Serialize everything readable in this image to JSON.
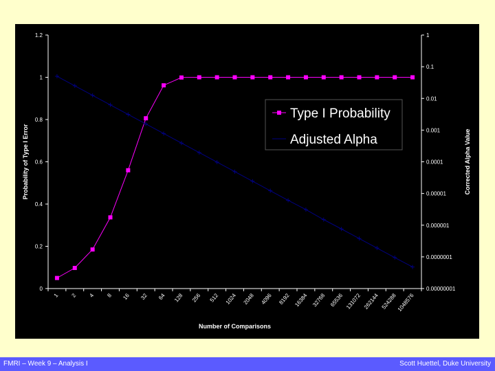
{
  "chart_data": {
    "type": "line",
    "xlabel": "Number of Comparisons",
    "ylabel": "Probability of Type I Error",
    "y2label": "Corrected Alpha Value",
    "categories": [
      "1",
      "2",
      "4",
      "8",
      "16",
      "32",
      "64",
      "128",
      "256",
      "512",
      "1024",
      "2048",
      "4096",
      "8192",
      "16384",
      "32768",
      "65536",
      "131072",
      "262144",
      "524288",
      "1048576"
    ],
    "ylim": [
      0,
      1.2
    ],
    "yticks": [
      "0",
      "0.2",
      "0.4",
      "0.6",
      "0.8",
      "1",
      "1.2"
    ],
    "y2lim": [
      1e-08,
      1
    ],
    "y2scale": "log",
    "y2ticks": [
      "0.00000001",
      "0.0000001",
      "0.000001",
      "0.00001",
      "0.0001",
      "0.001",
      "0.01",
      "0.1",
      "1"
    ],
    "legend_placement": "top-right",
    "grid": false,
    "series": [
      {
        "name": "Type I Probability",
        "axis": "left",
        "color": "#FF00FF",
        "marker": "square",
        "values": [
          0.05,
          0.0975,
          0.185,
          0.337,
          0.56,
          0.806,
          0.962,
          0.999,
          1,
          1,
          1,
          1,
          1,
          1,
          1,
          1,
          1,
          1,
          1,
          1,
          1
        ]
      },
      {
        "name": "Adjusted Alpha",
        "axis": "right",
        "color": "#000080",
        "marker": "plus",
        "values": [
          0.05,
          0.025,
          0.0125,
          0.00625,
          0.003125,
          0.0015625,
          0.00078125,
          0.000390625,
          0.0001953,
          9.77e-05,
          4.88e-05,
          2.44e-05,
          1.22e-05,
          6.1e-06,
          3.1e-06,
          1.5e-06,
          7.6e-07,
          3.8e-07,
          1.9e-07,
          9.5e-08,
          4.8e-08
        ]
      }
    ]
  },
  "footer": {
    "left": "FMRI – Week 9 – Analysis I",
    "right": "Scott Huettel, Duke University"
  }
}
